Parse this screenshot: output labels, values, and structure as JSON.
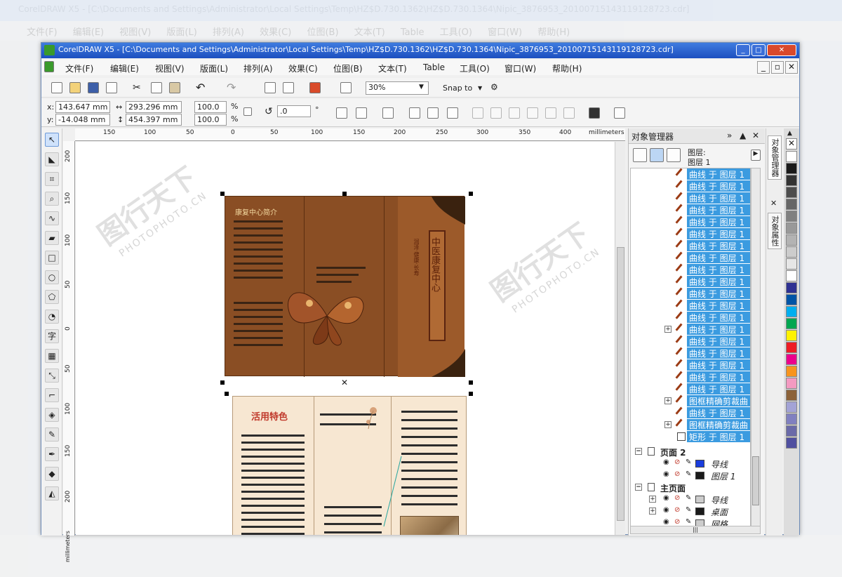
{
  "app": {
    "title": "CorelDRAW X5 - [C:\\Documents and Settings\\Administrator\\Local Settings\\Temp\\HZ$D.730.1362\\HZ$D.730.1364\\Nipic_3876953_20100715143119128723.cdr]",
    "bg_title": "CorelDRAW X5 - [C:\\Documents and Settings\\Administrator\\Local Settings\\Temp\\HZ$D.730.1362\\HZ$D.730.1364\\Nipic_3876953_20100715143119128723.cdr]"
  },
  "menu": [
    "文件(F)",
    "编辑(E)",
    "视图(V)",
    "版面(L)",
    "排列(A)",
    "效果(C)",
    "位图(B)",
    "文本(T)",
    "Table",
    "工具(O)",
    "窗口(W)",
    "帮助(H)"
  ],
  "toolbar": {
    "zoom": "30%",
    "snap": "Snap to"
  },
  "props": {
    "x_label": "x:",
    "x": "143.647 mm",
    "y_label": "y:",
    "y": "-14.048 mm",
    "w": "293.296 mm",
    "h": "454.397 mm",
    "sx": "100.0",
    "sy": "100.0",
    "pct": "%",
    "angle": ".0",
    "deg": "°"
  },
  "ruler": {
    "h_ticks": [
      "150",
      "100",
      "50",
      "0",
      "50",
      "100",
      "150",
      "200",
      "250",
      "300",
      "350",
      "400"
    ],
    "unit": "millimeters",
    "v_ticks": [
      "200",
      "150",
      "100",
      "50",
      "0",
      "50",
      "100",
      "150",
      "200"
    ],
    "v_unit": "millimeters"
  },
  "doc": {
    "brochure_title": "中医康复中心",
    "brochure_sub": "润泽·健康·长寿",
    "left_heading": "康复中心简介",
    "light_heading": "活用特色"
  },
  "watermark": {
    "cn": "图行天下",
    "en": "PHOTOPHOTO.CN"
  },
  "panel": {
    "title": "对象管理器",
    "layer_label": "图层:",
    "layer_name": "图层 1",
    "items": [
      "曲线 于 图层 1",
      "曲线 于 图层 1",
      "曲线 于 图层 1",
      "曲线 于 图层 1",
      "曲线 于 图层 1",
      "曲线 于 图层 1",
      "曲线 于 图层 1",
      "曲线 于 图层 1",
      "曲线 于 图层 1",
      "曲线 于 图层 1",
      "曲线 于 图层 1",
      "曲线 于 图层 1",
      "曲线 于 图层 1",
      "曲线 于 图层 1",
      "曲线 于 图层 1",
      "曲线 于 图层 1",
      "曲线 于 图层 1",
      "曲线 于 图层 1",
      "曲线 于 图层 1",
      "图框精确剪裁曲",
      "曲线 于 图层 1",
      "图框精确剪裁曲",
      "矩形 于 图层 1"
    ],
    "page2": "页面 2",
    "page2_layers": [
      "导线",
      "图层 1"
    ],
    "master": "主页面",
    "master_layers": [
      "导线",
      "桌面",
      "网格"
    ]
  },
  "vtabs": [
    "对象管理器",
    "对象属性"
  ],
  "colors": {
    "title_bar": "#2a5fd0",
    "selection": "#3b9be0",
    "brochure_outer": "#8a4e24",
    "brochure_inner": "#f7e7d2"
  },
  "palette": [
    "#ffffff",
    "#1a1a1a",
    "#333333",
    "#4d4d4d",
    "#666666",
    "#808080",
    "#999999",
    "#b3b3b3",
    "#cccccc",
    "#e6e6e6",
    "#ffffff",
    "#2e3192",
    "#0054a6",
    "#00aeef",
    "#00a651",
    "#fff200",
    "#ed1c24",
    "#ec008c",
    "#f7941d",
    "#f49ac1",
    "#8c6239",
    "#a3a3d6",
    "#8080c0",
    "#6a6aa8",
    "#5050a0"
  ]
}
